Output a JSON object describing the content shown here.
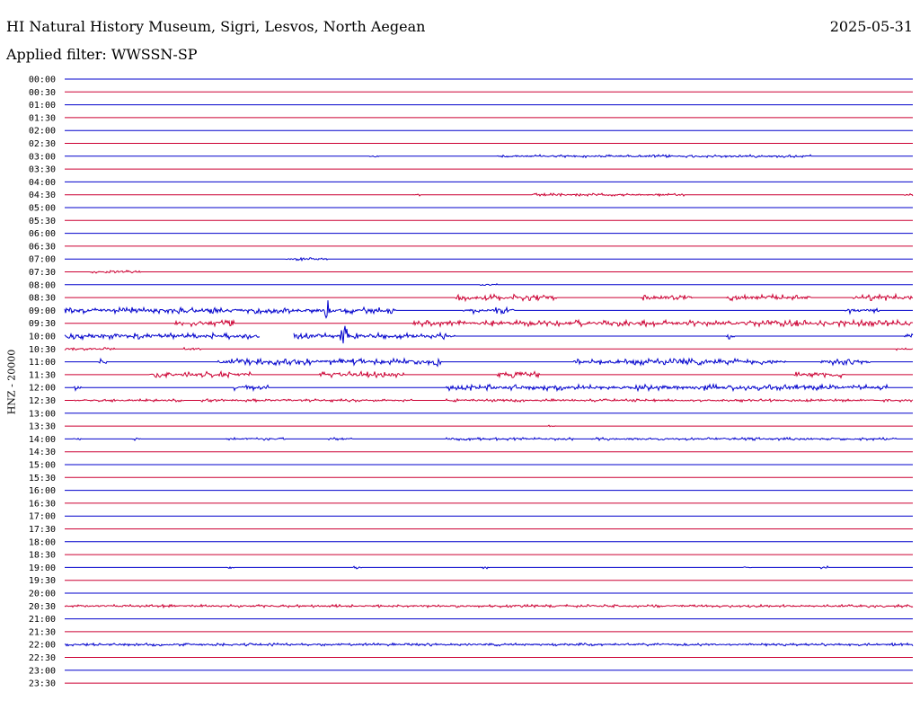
{
  "header": {
    "station": "HI Natural History Museum, Sigri, Lesvos, North Aegean",
    "date": "2025-05-31",
    "filter_prefix": "Applied filter:",
    "filter_name": "WWSSN-SP"
  },
  "chart_data": {
    "type": "line",
    "title": "HI Natural History Museum, Sigri, Lesvos, North Aegean",
    "date": "2025-05-31",
    "filter": "WWSSN-SP",
    "ylabel": "HNZ - 20000",
    "xlabel": "",
    "row_labels": [
      "00:00",
      "00:30",
      "01:00",
      "01:30",
      "02:00",
      "02:30",
      "03:00",
      "03:30",
      "04:00",
      "04:30",
      "05:00",
      "05:30",
      "06:00",
      "06:30",
      "07:00",
      "07:30",
      "08:00",
      "08:30",
      "09:00",
      "09:30",
      "10:00",
      "10:30",
      "11:00",
      "11:30",
      "12:00",
      "12:30",
      "13:00",
      "13:30",
      "14:00",
      "14:30",
      "15:00",
      "15:30",
      "16:00",
      "16:30",
      "17:00",
      "17:30",
      "18:00",
      "18:30",
      "19:00",
      "19:30",
      "20:00",
      "20:30",
      "21:00",
      "21:30",
      "22:00",
      "22:30",
      "23:00",
      "23:30"
    ],
    "trace_minutes": 30,
    "row_colors": [
      "#0000cc",
      "#cc0033"
    ],
    "activity": [
      {
        "row": "03:00",
        "level": 1,
        "segments": [
          [
            0.36,
            0.37
          ],
          [
            0.51,
            0.88
          ]
        ]
      },
      {
        "row": "04:30",
        "level": 1,
        "segments": [
          [
            0.41,
            0.42
          ],
          [
            0.55,
            0.73
          ],
          [
            0.99,
            1.0
          ]
        ]
      },
      {
        "row": "07:00",
        "level": 1,
        "segments": [
          [
            0.26,
            0.31
          ]
        ]
      },
      {
        "row": "07:30",
        "level": 1,
        "segments": [
          [
            0.03,
            0.09
          ]
        ]
      },
      {
        "row": "08:00",
        "level": 1,
        "segments": [
          [
            0.49,
            0.51
          ]
        ]
      },
      {
        "row": "08:30",
        "level": 2,
        "segments": [
          [
            0.46,
            0.54
          ],
          [
            0.54,
            0.58
          ],
          [
            0.68,
            0.74
          ],
          [
            0.78,
            0.88
          ],
          [
            0.93,
            1.0
          ]
        ]
      },
      {
        "row": "09:00",
        "level": 2,
        "segments": [
          [
            0.0,
            0.22
          ],
          [
            0.22,
            0.39
          ],
          [
            0.47,
            0.53
          ],
          [
            0.92,
            0.96
          ]
        ],
        "spikes": [
          {
            "pos": 0.31,
            "amp": 2.2
          }
        ]
      },
      {
        "row": "09:30",
        "level": 2,
        "segments": [
          [
            0.13,
            0.2
          ],
          [
            0.41,
            1.0
          ]
        ]
      },
      {
        "row": "10:00",
        "level": 2,
        "segments": [
          [
            0.0,
            0.23
          ],
          [
            0.27,
            0.46
          ],
          [
            0.78,
            0.79
          ],
          [
            0.99,
            1.0
          ]
        ],
        "spikes": [
          {
            "pos": 0.33,
            "amp": 2.6
          }
        ],
        "gaps": [
          [
            0.23,
            0.27
          ]
        ]
      },
      {
        "row": "10:30",
        "level": 1,
        "segments": [
          [
            0.0,
            0.06
          ],
          [
            0.14,
            0.16
          ],
          [
            0.98,
            1.0
          ]
        ]
      },
      {
        "row": "11:00",
        "level": 2,
        "segments": [
          [
            0.04,
            0.05
          ],
          [
            0.18,
            0.44
          ],
          [
            0.6,
            0.85
          ],
          [
            0.89,
            0.95
          ]
        ],
        "spikes": [
          {
            "pos": 0.44,
            "amp": 1.3
          }
        ]
      },
      {
        "row": "11:30",
        "level": 2,
        "segments": [
          [
            0.1,
            0.22
          ],
          [
            0.3,
            0.4
          ],
          [
            0.51,
            0.56
          ],
          [
            0.86,
            0.92
          ]
        ]
      },
      {
        "row": "12:00",
        "level": 2,
        "segments": [
          [
            0.01,
            0.02
          ],
          [
            0.2,
            0.24
          ],
          [
            0.45,
            0.52
          ],
          [
            0.52,
            0.97
          ]
        ]
      },
      {
        "row": "12:30",
        "level": 1,
        "segments": [
          [
            0.01,
            0.14
          ],
          [
            0.16,
            0.41
          ],
          [
            0.45,
            1.0
          ]
        ]
      },
      {
        "row": "13:30",
        "level": 1,
        "segments": [
          [
            0.57,
            0.58
          ]
        ]
      },
      {
        "row": "14:00",
        "level": 1,
        "segments": [
          [
            0.01,
            0.02
          ],
          [
            0.08,
            0.09
          ],
          [
            0.19,
            0.26
          ],
          [
            0.31,
            0.34
          ],
          [
            0.45,
            0.6
          ],
          [
            0.62,
            0.98
          ]
        ]
      },
      {
        "row": "19:00",
        "level": 1,
        "segments": [
          [
            0.19,
            0.2
          ],
          [
            0.34,
            0.35
          ],
          [
            0.49,
            0.5
          ],
          [
            0.8,
            0.81
          ],
          [
            0.89,
            0.9
          ]
        ]
      },
      {
        "row": "20:30",
        "level": 1,
        "segments": [
          [
            0.0,
            1.0
          ]
        ]
      },
      {
        "row": "22:00",
        "level": 1,
        "segments": [
          [
            0.0,
            1.0
          ]
        ]
      }
    ]
  }
}
